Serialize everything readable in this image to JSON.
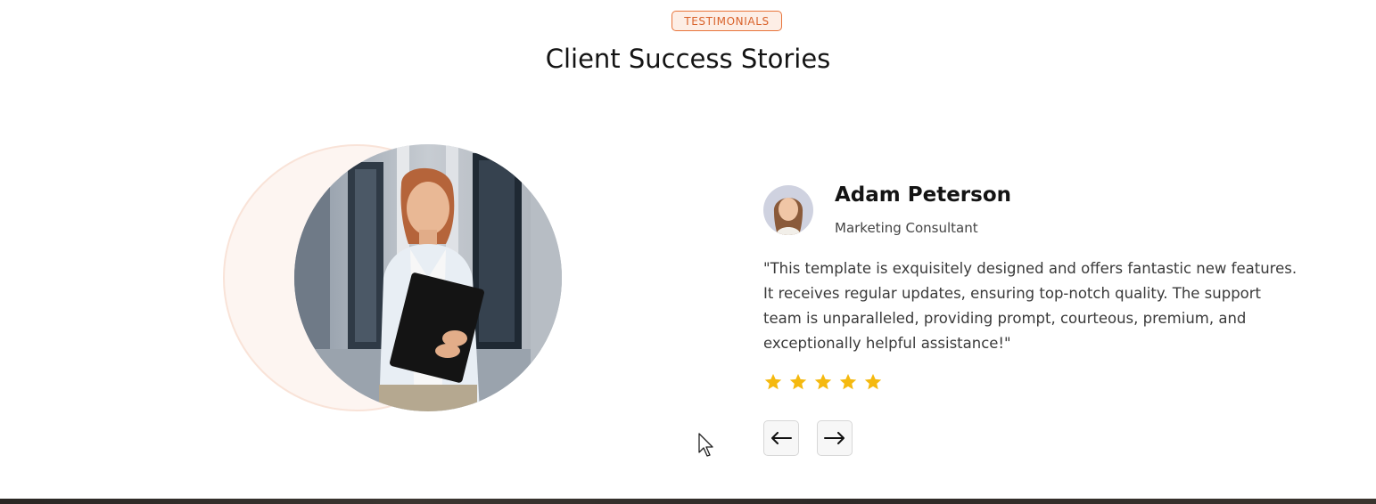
{
  "section": {
    "badge": "TESTIMONIALS",
    "title": "Client Success Stories"
  },
  "testimonial": {
    "name": "Adam Peterson",
    "role": "Marketing Consultant",
    "quote": "\"This template is exquisitely designed and offers fantastic new features. It receives regular updates, ensuring top-notch quality. The support team is unparalleled, providing prompt, courteous, premium, and exceptionally helpful assistance!\"",
    "rating": 5,
    "rating_max": 5
  },
  "nav": {
    "prev_icon": "arrow-left-icon",
    "next_icon": "arrow-right-icon"
  },
  "colors": {
    "accent": "#e8743b",
    "badge_bg": "#fdeee6",
    "star": "#f5b90f",
    "circle_bg": "#fdf5f1"
  }
}
